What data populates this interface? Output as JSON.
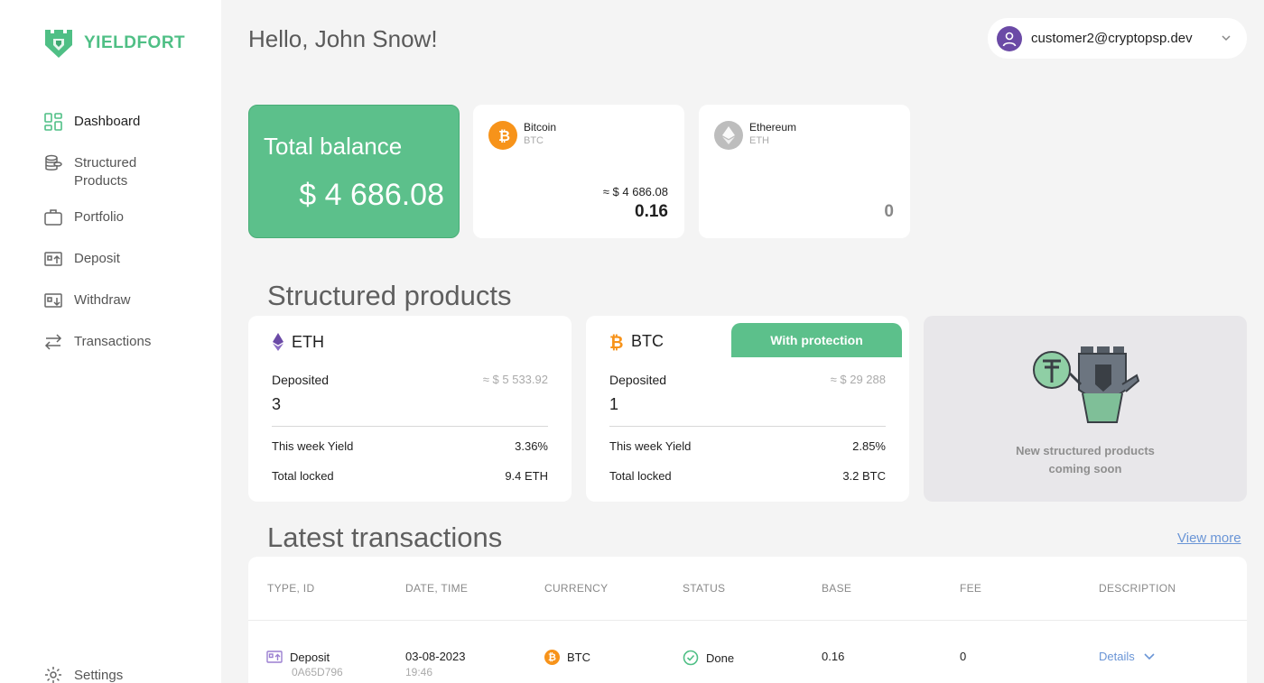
{
  "brand": {
    "name": "YIELDFORT",
    "color": "#4fbf85"
  },
  "sidebar": {
    "items": [
      {
        "label": "Dashboard",
        "icon": "dashboard-grid-icon",
        "active": true
      },
      {
        "label": "Structured Products",
        "icon": "coin-stack-icon"
      },
      {
        "label": "Portfolio",
        "icon": "briefcase-icon"
      },
      {
        "label": "Deposit",
        "icon": "deposit-icon"
      },
      {
        "label": "Withdraw",
        "icon": "withdraw-icon"
      },
      {
        "label": "Transactions",
        "icon": "swap-arrows-icon"
      }
    ],
    "settings_label": "Settings"
  },
  "header": {
    "greeting": "Hello, John Snow!",
    "user_email": "customer2@cryptopsp.dev"
  },
  "balance": {
    "title": "Total balance",
    "value": "$ 4 686.08",
    "coins": [
      {
        "name": "Bitcoin",
        "symbol": "BTC",
        "usd": "≈ $ 4 686.08",
        "amount": "0.16",
        "color": "#f7931a"
      },
      {
        "name": "Ethereum",
        "symbol": "ETH",
        "usd": "",
        "amount": "0",
        "color": "#bdbdbd"
      }
    ]
  },
  "structured": {
    "title": "Structured products",
    "products": [
      {
        "symbol": "ETH",
        "deposited_label": "Deposited",
        "deposited_usd": "≈ $ 5 533.92",
        "deposited": "3",
        "yield_label": "This week Yield",
        "yield": "3.36%",
        "locked_label": "Total locked",
        "locked": "9.4 ETH"
      },
      {
        "symbol": "BTC",
        "badge": "With protection",
        "deposited_label": "Deposited",
        "deposited_usd": "≈ $ 29 288",
        "deposited": "1",
        "yield_label": "This week Yield",
        "yield": "2.85%",
        "locked_label": "Total locked",
        "locked": "3.2 BTC"
      }
    ],
    "coming_soon_line1": "New structured products",
    "coming_soon_line2": "coming soon"
  },
  "transactions": {
    "title": "Latest transactions",
    "view_more": "View more",
    "columns": [
      "TYPE, ID",
      "DATE, TIME",
      "CURRENCY",
      "STATUS",
      "BASE",
      "FEE",
      "DESCRIPTION"
    ],
    "rows": [
      {
        "type": "Deposit",
        "id": "0A65D796",
        "date": "03-08-2023",
        "time": "19:46",
        "currency": "BTC",
        "status": "Done",
        "base": "0.16",
        "fee": "0",
        "description": "Details"
      }
    ]
  },
  "colors": {
    "accent": "#5cc08b",
    "link": "#6a95d6",
    "btc": "#f7931a",
    "eth_purple": "#6b4aa6"
  }
}
